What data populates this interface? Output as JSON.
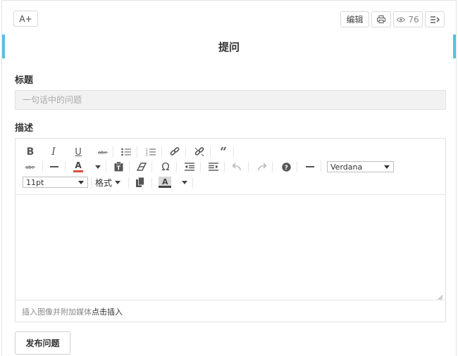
{
  "header": {
    "font_size_button_label": "A+",
    "edit_label": "编辑",
    "view_count": "76"
  },
  "page": {
    "title": "提问"
  },
  "form": {
    "title_label": "标题",
    "title_placeholder": "一句话中的问题",
    "description_label": "描述",
    "submit_label": "发布问题"
  },
  "editor": {
    "font_family_value": "Verdana",
    "font_size_value": "11pt",
    "format_label": "格式",
    "footer_text": "插入图像并附加媒体",
    "footer_link": "点击插入"
  },
  "colors": {
    "accent": "#5bc0de",
    "text_color_swatch": "#e04b3c",
    "bg_color_swatch": "#d9d9d9"
  }
}
